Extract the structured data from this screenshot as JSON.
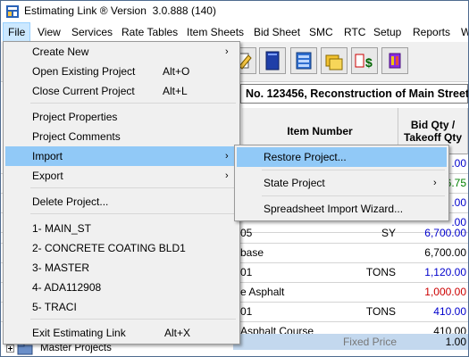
{
  "title": "Estimating Link ® Version  3.0.888 (140)",
  "menubar": [
    "File",
    "View",
    "Services",
    "Rate Tables",
    "Item Sheets",
    "Bid Sheet",
    "SMC",
    "RTC",
    "Setup",
    "Reports",
    "W"
  ],
  "project_header": "No. 123456, Reconstruction of Main Street",
  "grid": {
    "col_item": "Item Number",
    "col_qty_1": "Bid Qty /",
    "col_qty_2": "Takeoff Qty",
    "rows": [
      {
        "a": "",
        "b": "",
        "q": ".00",
        "qc": "blue"
      },
      {
        "a": "",
        "b": "",
        "q": "6.75",
        "qc": "green"
      },
      {
        "a": "",
        "b": "",
        "q": ".00",
        "qc": "blue"
      },
      {
        "a": "",
        "b": "",
        "q": ".00",
        "qc": "blue"
      },
      {
        "a": "05",
        "b": "SY",
        "q": "6,700.00",
        "qc": "blue"
      },
      {
        "a": "base",
        "b": "",
        "q": "6,700.00",
        "qc": ""
      },
      {
        "a": "01",
        "b": "TONS",
        "q": "1,120.00",
        "qc": "blue"
      },
      {
        "a": "e Asphalt",
        "b": "",
        "q": "1,000.00",
        "qc": "red"
      },
      {
        "a": "01",
        "b": "TONS",
        "q": "410.00",
        "qc": "blue"
      },
      {
        "a": "Asphalt Course",
        "b": "",
        "q": "410.00",
        "qc": ""
      },
      {
        "a": "",
        "b": "Fixed Price",
        "q": "1.00",
        "qc": ""
      }
    ]
  },
  "tree_label": "Master Projects",
  "file_menu": {
    "items": [
      {
        "label": "Create New",
        "shortcut": "",
        "arrow": true
      },
      {
        "label": "Open Existing Project",
        "shortcut": "Alt+O",
        "arrow": false
      },
      {
        "label": "Close Current Project",
        "shortcut": "Alt+L",
        "arrow": false
      },
      {
        "label": "Project Properties",
        "shortcut": "",
        "arrow": false
      },
      {
        "label": "Project Comments",
        "shortcut": "",
        "arrow": false
      },
      {
        "label": "Import",
        "shortcut": "",
        "arrow": true
      },
      {
        "label": "Export",
        "shortcut": "",
        "arrow": true
      },
      {
        "label": "Delete Project...",
        "shortcut": "",
        "arrow": false
      },
      {
        "label": "1- MAIN_ST",
        "shortcut": "",
        "arrow": false
      },
      {
        "label": "2- CONCRETE COATING BLD1",
        "shortcut": "",
        "arrow": false
      },
      {
        "label": "3- MASTER",
        "shortcut": "",
        "arrow": false
      },
      {
        "label": "4- ADA112908",
        "shortcut": "",
        "arrow": false
      },
      {
        "label": "5- TRACI",
        "shortcut": "",
        "arrow": false
      },
      {
        "label": "Exit Estimating Link",
        "shortcut": "Alt+X",
        "arrow": false
      }
    ]
  },
  "import_menu": {
    "items": [
      {
        "label": "Restore Project...",
        "arrow": false
      },
      {
        "label": "State Project",
        "arrow": true
      },
      {
        "label": "Spreadsheet Import Wizard...",
        "arrow": false
      }
    ]
  },
  "colors": {
    "accent": "#91c9f7",
    "menu_active": "#cce8ff",
    "blue_text": "#0000cc",
    "red_text": "#cc0000",
    "green_text": "#008000"
  }
}
